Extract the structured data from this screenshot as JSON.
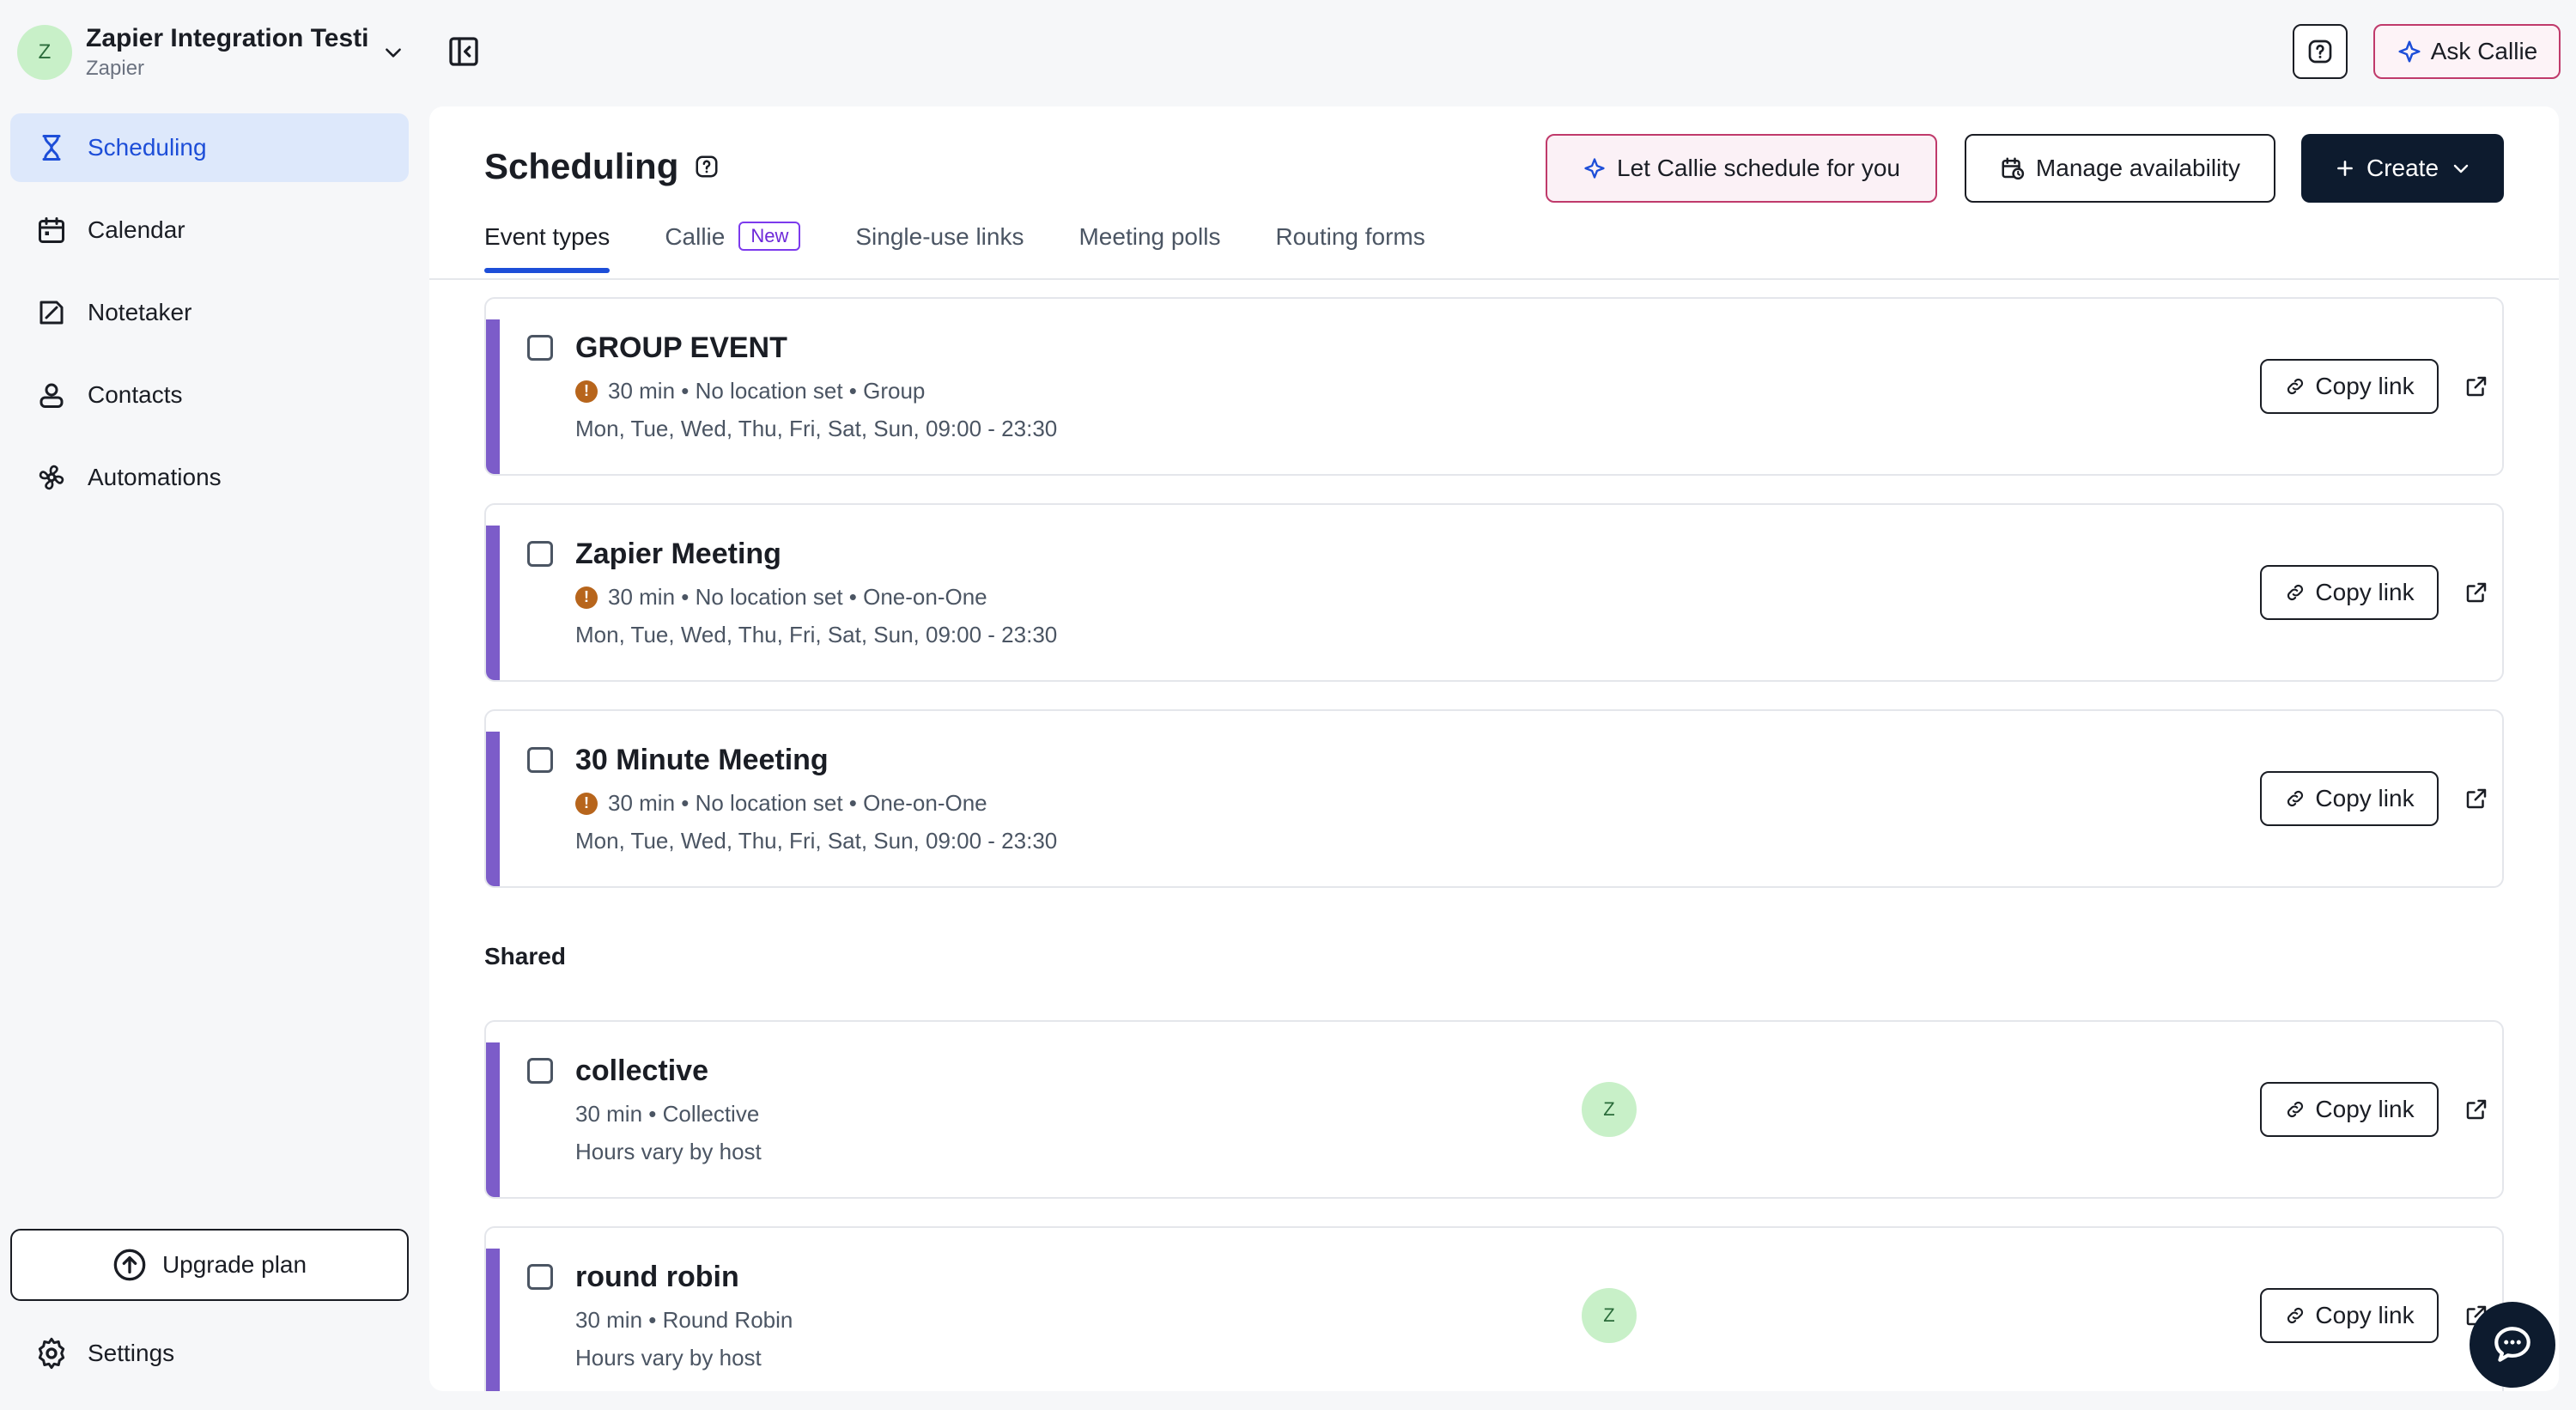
{
  "account": {
    "avatar_initial": "Z",
    "name": "Zapier Integration Testing",
    "sub": "Zapier"
  },
  "sidebar": {
    "items": [
      {
        "label": "Scheduling",
        "icon": "hourglass-icon",
        "active": true
      },
      {
        "label": "Calendar",
        "icon": "calendar-icon"
      },
      {
        "label": "Notetaker",
        "icon": "notetaker-icon"
      },
      {
        "label": "Contacts",
        "icon": "contacts-icon"
      },
      {
        "label": "Automations",
        "icon": "automations-icon"
      }
    ],
    "upgrade_label": "Upgrade plan",
    "settings_label": "Settings"
  },
  "topbar": {
    "ask_label": "Ask Callie"
  },
  "main": {
    "title": "Scheduling",
    "actions": {
      "callie_label": "Let Callie schedule for you",
      "manage_label": "Manage availability",
      "create_label": "Create"
    },
    "tabs": [
      {
        "label": "Event types",
        "active": true
      },
      {
        "label": "Callie",
        "badge": "New"
      },
      {
        "label": "Single-use links"
      },
      {
        "label": "Meeting polls"
      },
      {
        "label": "Routing forms"
      }
    ],
    "events": [
      {
        "title": "GROUP EVENT",
        "meta": "30 min • No location set • Group",
        "hours": "Mon, Tue, Wed, Thu, Fri, Sat, Sun, 09:00 - 23:30",
        "warning": true
      },
      {
        "title": "Zapier Meeting",
        "meta": "30 min • No location set • One-on-One",
        "hours": "Mon, Tue, Wed, Thu, Fri, Sat, Sun, 09:00 - 23:30",
        "warning": true
      },
      {
        "title": "30 Minute Meeting",
        "meta": "30 min • No location set • One-on-One",
        "hours": "Mon, Tue, Wed, Thu, Fri, Sat, Sun, 09:00 - 23:30",
        "warning": true
      }
    ],
    "shared_label": "Shared",
    "shared": [
      {
        "title": "collective",
        "meta": "30 min • Collective",
        "hours": "Hours vary by host",
        "host": "Z"
      },
      {
        "title": "round robin",
        "meta": "30 min • Round Robin",
        "hours": "Hours vary by host",
        "host": "Z"
      }
    ],
    "copy_label": "Copy link"
  },
  "colors": {
    "accent": "#1d4ed8",
    "event_bar": "#7c5cc9",
    "create_bg": "#0d1b2e",
    "callie_border": "#c03a6b",
    "warning": "#b7651c"
  }
}
